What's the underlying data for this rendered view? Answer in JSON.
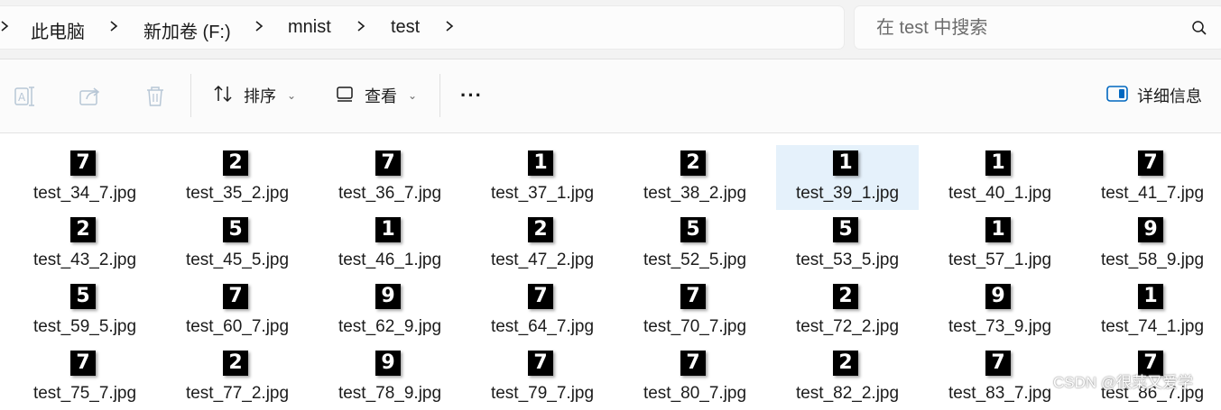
{
  "breadcrumb": {
    "items": [
      "此电脑",
      "新加卷 (F:)",
      "mnist",
      "test"
    ]
  },
  "search": {
    "placeholder": "在 test 中搜索"
  },
  "toolbar": {
    "sort_label": "排序",
    "view_label": "查看",
    "more_label": "···",
    "details_label": "详细信息"
  },
  "files": [
    {
      "name": "test_34_7.jpg",
      "digit": "7"
    },
    {
      "name": "test_35_2.jpg",
      "digit": "2"
    },
    {
      "name": "test_36_7.jpg",
      "digit": "7"
    },
    {
      "name": "test_37_1.jpg",
      "digit": "1"
    },
    {
      "name": "test_38_2.jpg",
      "digit": "2"
    },
    {
      "name": "test_39_1.jpg",
      "digit": "1",
      "selected": true
    },
    {
      "name": "test_40_1.jpg",
      "digit": "1"
    },
    {
      "name": "test_41_7.jpg",
      "digit": "7"
    },
    {
      "name": "test_43_2.jpg",
      "digit": "2"
    },
    {
      "name": "test_45_5.jpg",
      "digit": "5"
    },
    {
      "name": "test_46_1.jpg",
      "digit": "1"
    },
    {
      "name": "test_47_2.jpg",
      "digit": "2"
    },
    {
      "name": "test_52_5.jpg",
      "digit": "5"
    },
    {
      "name": "test_53_5.jpg",
      "digit": "5"
    },
    {
      "name": "test_57_1.jpg",
      "digit": "1"
    },
    {
      "name": "test_58_9.jpg",
      "digit": "9"
    },
    {
      "name": "test_59_5.jpg",
      "digit": "5"
    },
    {
      "name": "test_60_7.jpg",
      "digit": "7"
    },
    {
      "name": "test_62_9.jpg",
      "digit": "9"
    },
    {
      "name": "test_64_7.jpg",
      "digit": "7"
    },
    {
      "name": "test_70_7.jpg",
      "digit": "7"
    },
    {
      "name": "test_72_2.jpg",
      "digit": "2"
    },
    {
      "name": "test_73_9.jpg",
      "digit": "9"
    },
    {
      "name": "test_74_1.jpg",
      "digit": "1"
    },
    {
      "name": "test_75_7.jpg",
      "digit": "7"
    },
    {
      "name": "test_77_2.jpg",
      "digit": "2"
    },
    {
      "name": "test_78_9.jpg",
      "digit": "9"
    },
    {
      "name": "test_79_7.jpg",
      "digit": "7"
    },
    {
      "name": "test_80_7.jpg",
      "digit": "7"
    },
    {
      "name": "test_82_2.jpg",
      "digit": "2"
    },
    {
      "name": "test_83_7.jpg",
      "digit": "7"
    },
    {
      "name": "test_86_7.jpg",
      "digit": "7"
    }
  ],
  "watermark": "CSDN @很菜又爱学",
  "colors": {
    "selection": "#e5f1fb",
    "accent": "#0067c0"
  }
}
